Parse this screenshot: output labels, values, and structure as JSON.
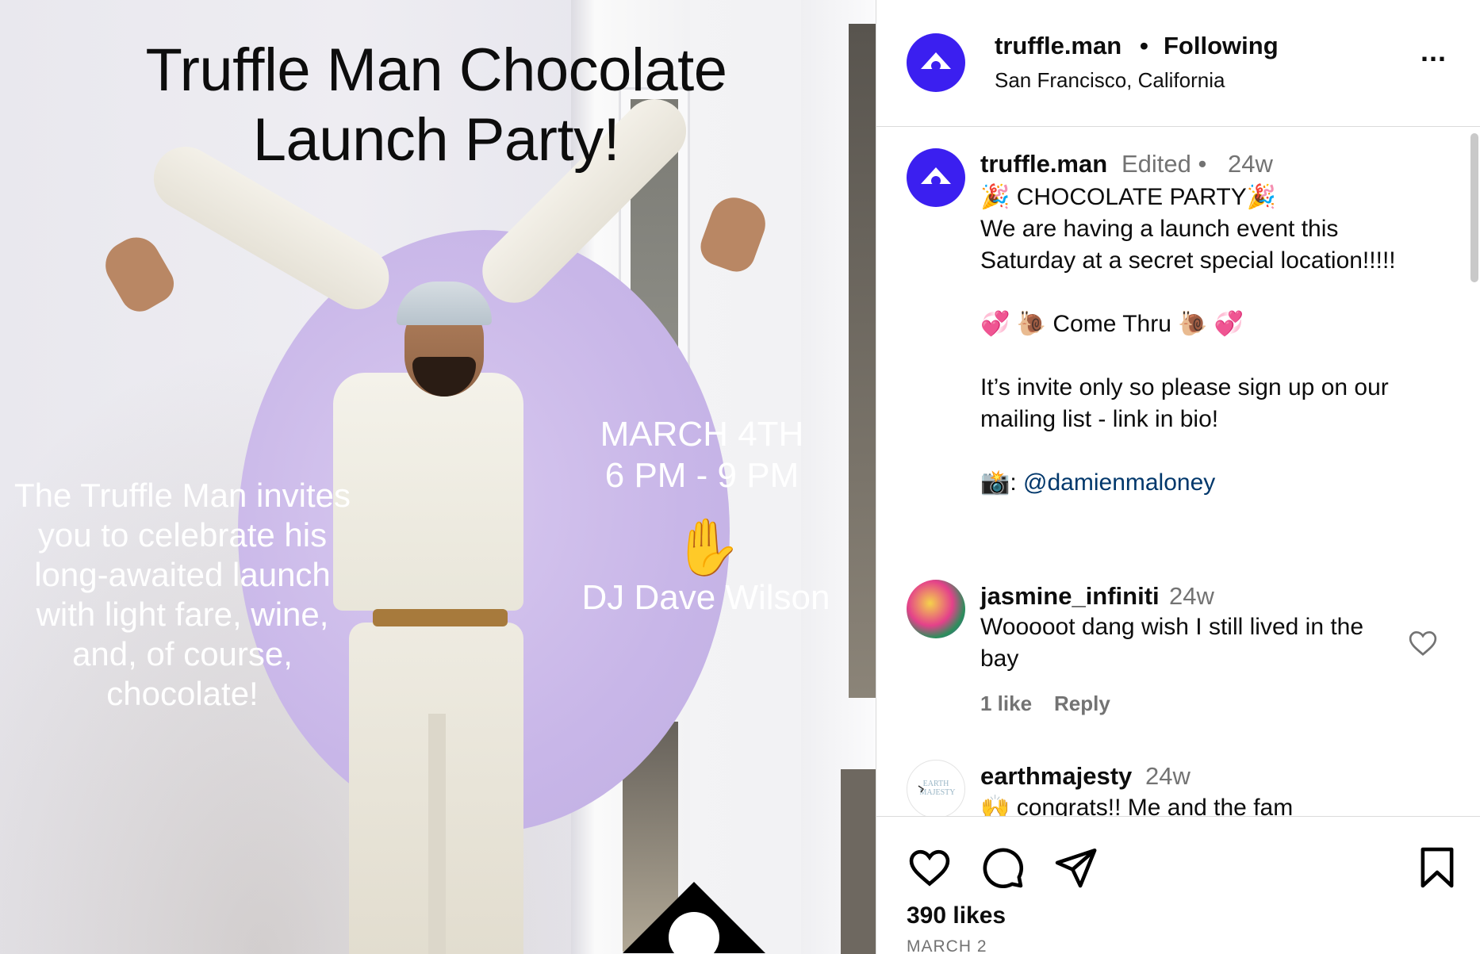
{
  "image": {
    "title_line1": "Truffle Man Chocolate",
    "title_line2": "Launch Party!",
    "invite_text": "The Truffle Man invites you to celebrate his long-awaited launch with light fare, wine, and, of course, chocolate!",
    "date_line1": "MARCH 4TH",
    "date_line2": "6 PM - 9 PM",
    "hand_glyph": "✋",
    "dj_text": "DJ Dave Wilson"
  },
  "header": {
    "username": "truffle.man",
    "separator": "•",
    "follow_status": "Following",
    "location": "San Francisco, California",
    "more_label": "..."
  },
  "caption": {
    "username": "truffle.man",
    "edited": "Edited •",
    "time": "24w",
    "lines": [
      "🎉 CHOCOLATE PARTY🎉",
      "We are having a launch event this",
      "Saturday at a secret special location!!!!!",
      "",
      "💞 🐌 Come Thru 🐌 💞",
      "",
      "It’s invite only so please sign up on our",
      "mailing list - link in bio!",
      ""
    ],
    "credit_prefix": "📸: ",
    "credit_mention": "@damienmaloney"
  },
  "comments": [
    {
      "username": "jasmine_infiniti",
      "time": "24w",
      "text": "Wooooot dang wish I still lived in the bay",
      "likes": "1 like",
      "reply": "Reply"
    },
    {
      "username": "earthmajesty",
      "time": "24w",
      "text": "🙌 congrats!! Me and the fam"
    }
  ],
  "footer": {
    "likes": "390 likes",
    "date": "MARCH 2"
  },
  "colors": {
    "brand_avatar": "#3b1ff0",
    "mention": "#00376b",
    "muted": "#737373",
    "divider": "#dbdbdb"
  }
}
